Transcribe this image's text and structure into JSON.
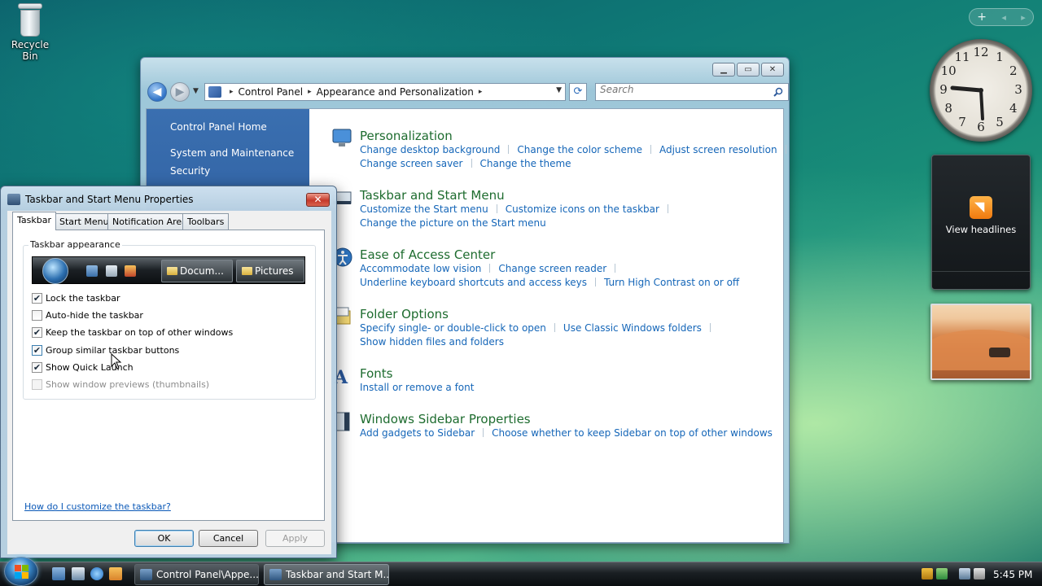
{
  "desktop": {
    "recycle_bin_label": "Recycle Bin"
  },
  "sidebar": {
    "clock_numbers": [
      "12",
      "1",
      "2",
      "3",
      "4",
      "5",
      "6",
      "7",
      "8",
      "9",
      "10",
      "11"
    ],
    "clock_time": "5:45",
    "feed_label": "View headlines",
    "icons": {
      "add": "plus-icon",
      "prev": "arrow-left-icon",
      "next": "arrow-right-icon",
      "feed": "rss-icon"
    }
  },
  "control_panel": {
    "caption_buttons": [
      "minimize",
      "maximize",
      "close"
    ],
    "breadcrumb": [
      "Control Panel",
      "Appearance and Personalization"
    ],
    "search_placeholder": "Search",
    "left_nav": [
      "Control Panel Home",
      "System and Maintenance",
      "Security"
    ],
    "categories": [
      {
        "title": "Personalization",
        "icon": "personalization-icon",
        "links": [
          [
            "Change desktop background",
            "Change the color scheme",
            "Adjust screen resolution"
          ],
          [
            "Change screen saver",
            "Change the theme"
          ]
        ]
      },
      {
        "title": "Taskbar and Start Menu",
        "icon": "taskbar-icon",
        "links": [
          [
            "Customize the Start menu",
            "Customize icons on the taskbar"
          ],
          [
            "Change the picture on the Start menu"
          ]
        ]
      },
      {
        "title": "Ease of Access Center",
        "icon": "ease-of-access-icon",
        "links": [
          [
            "Accommodate low vision",
            "Change screen reader"
          ],
          [
            "Underline keyboard shortcuts and access keys",
            "Turn High Contrast on or off"
          ]
        ]
      },
      {
        "title": "Folder Options",
        "icon": "folder-options-icon",
        "links": [
          [
            "Specify single- or double-click to open",
            "Use Classic Windows folders"
          ],
          [
            "Show hidden files and folders"
          ]
        ]
      },
      {
        "title": "Fonts",
        "icon": "fonts-icon",
        "links": [
          [
            "Install or remove a font"
          ]
        ]
      },
      {
        "title": "Windows Sidebar Properties",
        "icon": "sidebar-icon",
        "links": [
          [
            "Add gadgets to Sidebar",
            "Choose whether to keep Sidebar on top of other windows"
          ]
        ]
      }
    ]
  },
  "dialog": {
    "title": "Taskbar and Start Menu Properties",
    "close_glyph": "✕",
    "tabs": [
      "Taskbar",
      "Start Menu",
      "Notification Area",
      "Toolbars"
    ],
    "active_tab": "Taskbar",
    "group_label": "Taskbar appearance",
    "preview_buttons": [
      "Docum...",
      "Pictures"
    ],
    "options": [
      {
        "label": "Lock the taskbar",
        "checked": true,
        "enabled": true
      },
      {
        "label": "Auto-hide the taskbar",
        "checked": false,
        "enabled": true
      },
      {
        "label": "Keep the taskbar on top of other windows",
        "checked": true,
        "enabled": true
      },
      {
        "label": "Group similar taskbar buttons",
        "checked": true,
        "enabled": true
      },
      {
        "label": "Show Quick Launch",
        "checked": true,
        "enabled": true
      },
      {
        "label": "Show window previews (thumbnails)",
        "checked": false,
        "enabled": false
      }
    ],
    "help_link": "How do I customize the taskbar?",
    "buttons": {
      "ok": "OK",
      "cancel": "Cancel",
      "apply": "Apply"
    }
  },
  "taskbar": {
    "tasks": [
      {
        "label": "Control Panel\\Appe...",
        "active": false
      },
      {
        "label": "Taskbar and Start M...",
        "active": true
      }
    ],
    "clock": "5:45 PM"
  },
  "colors": {
    "link": "#1566b8",
    "category_title": "#1e6c2f",
    "nav_pane": "#2d5d9e"
  }
}
